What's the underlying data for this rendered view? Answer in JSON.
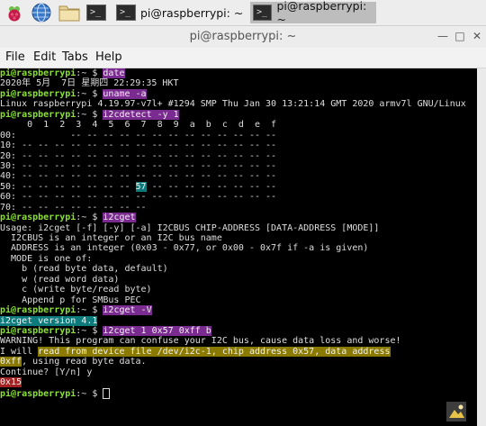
{
  "taskbar": {
    "tasks": [
      {
        "label": "pi@raspberrypi: ~"
      },
      {
        "label": "pi@raspberrypi: ~"
      }
    ]
  },
  "window": {
    "title": "pi@raspberrypi: ~",
    "menu": [
      "File",
      "Edit",
      "Tabs",
      "Help"
    ]
  },
  "prompt": {
    "user_host": "pi@raspberrypi",
    "sep": ":~ $ "
  },
  "terminal": {
    "l1_cmd": "date",
    "l2": "2020年 5月  7日 星期四 22:29:35 HKT",
    "l3_cmd": "uname -a",
    "l4": "Linux raspberrypi 4.19.97-v7l+ #1294 SMP Thu Jan 30 13:21:14 GMT 2020 armv7l GNU/Linux",
    "l5_cmd": "i2cdetect -y 1",
    "i2c_header": "     0  1  2  3  4  5  6  7  8  9  a  b  c  d  e  f",
    "i2c_rows": [
      "00:          -- -- -- -- -- -- -- -- -- -- -- -- --",
      "10: -- -- -- -- -- -- -- -- -- -- -- -- -- -- -- --",
      "20: -- -- -- -- -- -- -- -- -- -- -- -- -- -- -- --",
      "30: -- -- -- -- -- -- -- -- -- -- -- -- -- -- -- --",
      "40: -- -- -- -- -- -- -- -- -- -- -- -- -- -- -- --"
    ],
    "row50_pre": "50: -- -- -- -- -- -- -- ",
    "row50_hit": "57",
    "row50_post": " -- -- -- -- -- -- -- --",
    "i2c_rows_after": [
      "60: -- -- -- -- -- -- -- -- -- -- -- -- -- -- -- --",
      "70: -- -- -- -- -- -- -- --"
    ],
    "l6_cmd": "i2cget",
    "usage": [
      "Usage: i2cget [-f] [-y] [-a] I2CBUS CHIP-ADDRESS [DATA-ADDRESS [MODE]]",
      "  I2CBUS is an integer or an I2C bus name",
      "  ADDRESS is an integer (0x03 - 0x77, or 0x00 - 0x7f if -a is given)",
      "  MODE is one of:",
      "    b (read byte data, default)",
      "    w (read word data)",
      "    c (write byte/read byte)",
      "    Append p for SMBus PEC"
    ],
    "l7_cmd": "i2cget -V",
    "version": "i2cget version 4.1",
    "l8_cmd": "i2cget 1 0x57 0xff b",
    "warning": "WARNING! This program can confuse your I2C bus, cause data loss and worse!",
    "will_pre": "I will ",
    "will_hl": "read from device file /dev/i2c-1, chip address 0x57, data address",
    "addr_hl": "0xff",
    "addr_rest": ", using read byte data.",
    "continue": "Continue? [Y/n] y",
    "result": "0x15"
  }
}
